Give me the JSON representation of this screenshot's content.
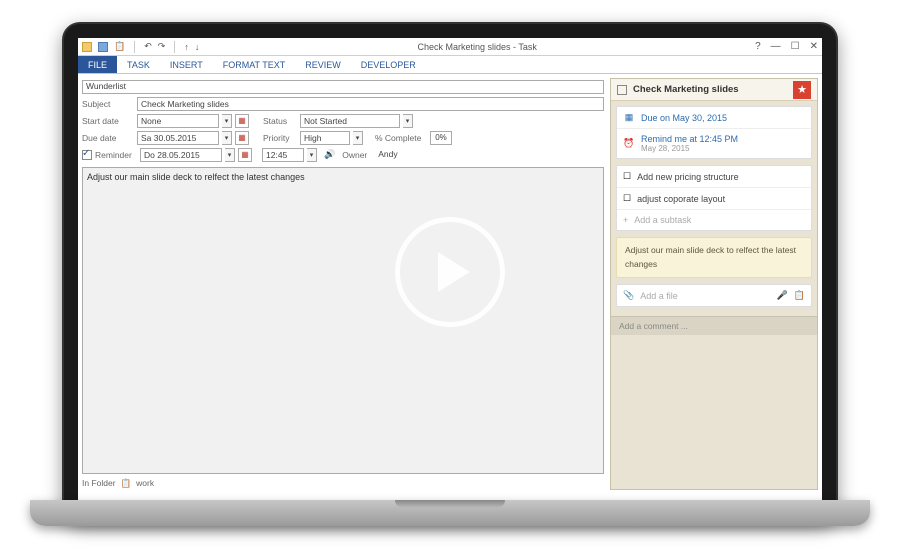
{
  "window": {
    "title": "Check Marketing slides - Task",
    "qat": {
      "folder": "☰",
      "save": "💾",
      "clip": "📋",
      "undo": "↶",
      "redo": "↷",
      "up": "↑",
      "down": "↓"
    },
    "winbtns": {
      "help": "?",
      "min": "—",
      "max": "☐",
      "close": "✕"
    }
  },
  "ribbon": {
    "tabs": [
      "FILE",
      "TASK",
      "INSERT",
      "FORMAT TEXT",
      "REVIEW",
      "DEVELOPER"
    ],
    "active_index": 3
  },
  "form": {
    "category": "Wunderlist",
    "subject_label": "Subject",
    "subject": "Check Marketing slides",
    "start_label": "Start date",
    "start_value": "None",
    "status_label": "Status",
    "status_value": "Not Started",
    "due_label": "Due date",
    "due_value": "Sa 30.05.2015",
    "priority_label": "Priority",
    "priority_value": "High",
    "pct_label": "% Complete",
    "pct_value": "0%",
    "reminder_label": "Reminder",
    "reminder_checked": true,
    "reminder_date": "Do 28.05.2015",
    "reminder_time": "12:45",
    "owner_label": "Owner",
    "owner_value": "Andy",
    "notes": "Adjust our main slide deck to relfect the latest changes"
  },
  "footer": {
    "in_folder_label": "In Folder",
    "folder": "work"
  },
  "sidebar": {
    "title": "Check Marketing slides",
    "due": "Due on May 30, 2015",
    "remind": "Remind me at 12:45 PM",
    "remind_sub": "May 28, 2015",
    "subtasks": [
      "Add new pricing structure",
      "adjust coporate layout"
    ],
    "add_subtask": "Add a subtask",
    "note": "Adjust our main slide deck to relfect the latest changes",
    "add_file": "Add a file",
    "add_comment": "Add a comment ..."
  },
  "icons": {
    "calendar": "▦",
    "alarm": "⏰",
    "checkbox": "☐",
    "plus": "+",
    "paperclip": "𝄐",
    "note": "▤",
    "star": "★",
    "play": "▶",
    "down": "▾"
  }
}
